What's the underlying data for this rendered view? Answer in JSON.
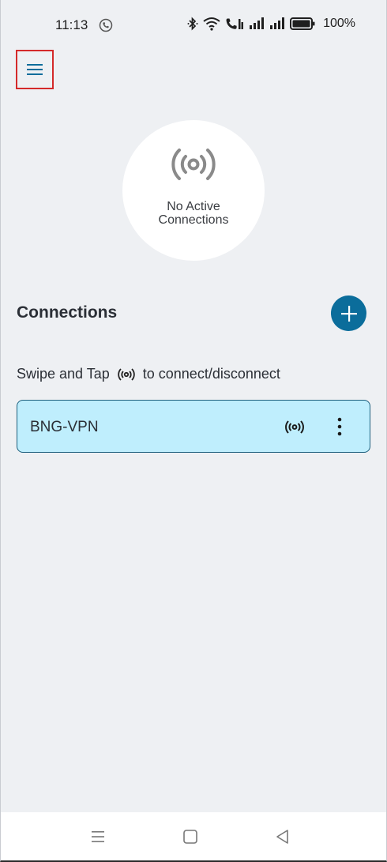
{
  "status_bar": {
    "time": "11:13",
    "battery": "100%",
    "icons": [
      "phone-call-icon",
      "bluetooth-icon",
      "wifi-icon",
      "volte-call-icon",
      "signal-icon",
      "signal-icon",
      "battery-icon"
    ]
  },
  "header": {
    "menu_icon": "hamburger-menu-icon"
  },
  "status": {
    "line1": "No Active",
    "line2": "Connections",
    "icon": "broadcast-icon"
  },
  "connections": {
    "title": "Connections",
    "add_icon": "plus-icon",
    "hint_before": "Swipe and Tap",
    "hint_after": "to connect/disconnect",
    "items": [
      {
        "name": "BNG-VPN",
        "icon": "broadcast-icon",
        "menu_icon": "more-vert-icon"
      }
    ]
  },
  "colors": {
    "accent": "#0b6d9b",
    "row_background": "#bfeefd",
    "row_border": "#1c5f7d",
    "page_background": "#eef0f3",
    "highlight": "#d42a2a"
  },
  "nav": {
    "buttons": [
      "recents-icon",
      "home-icon",
      "back-icon"
    ]
  }
}
